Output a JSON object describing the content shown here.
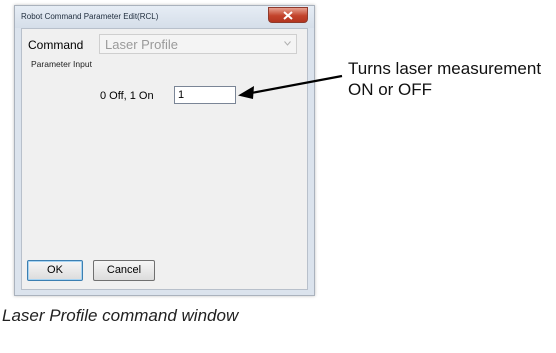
{
  "window": {
    "title": "Robot Command Parameter Edit(RCL)"
  },
  "command": {
    "label": "Command",
    "selected_value": "Laser Profile"
  },
  "parameter_section": {
    "label": "Parameter Input",
    "field_label": "0 Off, 1 On",
    "field_value": "1"
  },
  "buttons": {
    "ok_label": "OK",
    "cancel_label": "Cancel"
  },
  "annotation": {
    "text": "Turns laser measurement ON or OFF"
  },
  "caption": {
    "text": "Laser Profile command window"
  },
  "icons": {
    "close": "close-icon",
    "dropdown": "chevron-down-icon",
    "pointer": "arrow-icon"
  },
  "colors": {
    "close_button": "#c3432c",
    "window_frame": "#dbe3ed"
  }
}
